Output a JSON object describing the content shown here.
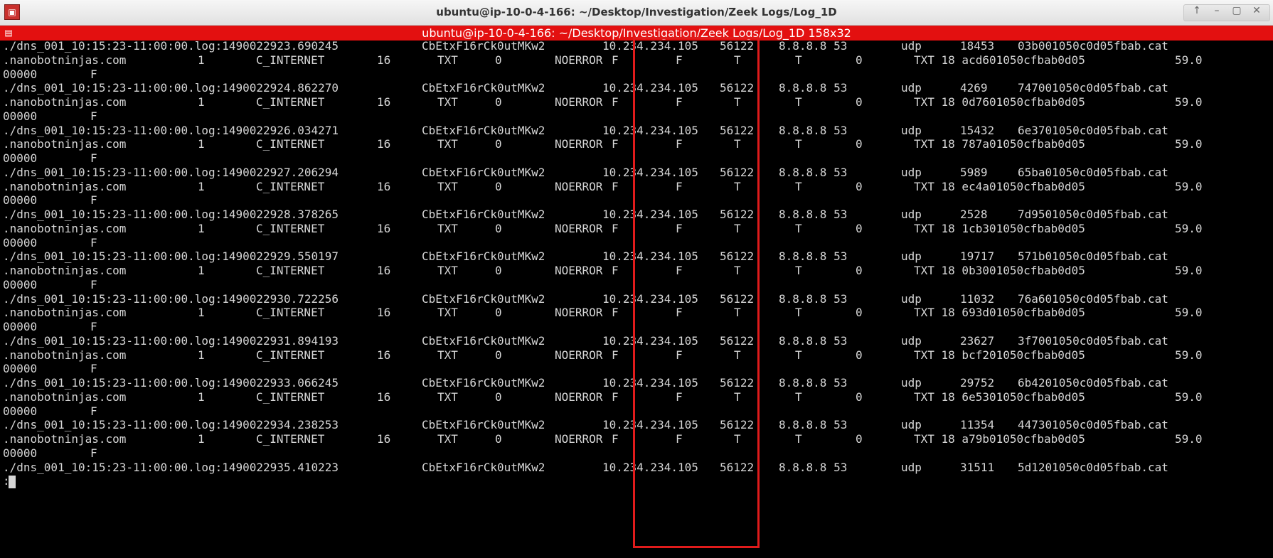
{
  "window": {
    "title": "ubuntu@ip-10-0-4-166: ~/Desktop/Investigation/Zeek Logs/Log_1D",
    "app_icon": "terminal-app-icon",
    "controls": [
      "↑",
      "–",
      "▢",
      "✕"
    ]
  },
  "terminal_bar": {
    "title": "ubuntu@ip-10-0-4-166: ~/Desktop/Investigation/Zeek Logs/Log_1D 158x32",
    "icon": "terminal-menu-icon"
  },
  "colors": {
    "terminal_bg": "#000000",
    "terminal_fg": "#d6d6d6",
    "terminal_bar": "#e31010",
    "highlight": "#e01b1b"
  },
  "records": [
    {
      "src": "./dns_001_10:15:23-11:00:00.log:1490022923.690245",
      "uid": "CbEtxF16rCk0utMKw2",
      "ip": "10.234.234.105",
      "port": "56122",
      "resp": "8.8.8.8 53",
      "proto": "udp",
      "trans": "18453",
      "qhead": "03b001050c0d05fbab.cat",
      "qtail": ".nanobotninjas.com",
      "c1": "1",
      "cname": "C_INTERNET",
      "qtype": "16",
      "qtname": "TXT",
      "rc": "0",
      "rcname": "NOERROR",
      "f1": "F",
      "f2": "F",
      "t1": "T",
      "t2": "T",
      "z": "0",
      "ans": "TXT 18 acd601050cfbab0d05",
      "ttl": "59.0",
      "wrap": "00000",
      "last": "F"
    },
    {
      "src": "./dns_001_10:15:23-11:00:00.log:1490022924.862270",
      "uid": "CbEtxF16rCk0utMKw2",
      "ip": "10.234.234.105",
      "port": "56122",
      "resp": "8.8.8.8 53",
      "proto": "udp",
      "trans": "4269",
      "qhead": "747001050c0d05fbab.cat",
      "qtail": ".nanobotninjas.com",
      "c1": "1",
      "cname": "C_INTERNET",
      "qtype": "16",
      "qtname": "TXT",
      "rc": "0",
      "rcname": "NOERROR",
      "f1": "F",
      "f2": "F",
      "t1": "T",
      "t2": "T",
      "z": "0",
      "ans": "TXT 18 0d7601050cfbab0d05",
      "ttl": "59.0",
      "wrap": "00000",
      "last": "F"
    },
    {
      "src": "./dns_001_10:15:23-11:00:00.log:1490022926.034271",
      "uid": "CbEtxF16rCk0utMKw2",
      "ip": "10.234.234.105",
      "port": "56122",
      "resp": "8.8.8.8 53",
      "proto": "udp",
      "trans": "15432",
      "qhead": "6e3701050c0d05fbab.cat",
      "qtail": ".nanobotninjas.com",
      "c1": "1",
      "cname": "C_INTERNET",
      "qtype": "16",
      "qtname": "TXT",
      "rc": "0",
      "rcname": "NOERROR",
      "f1": "F",
      "f2": "F",
      "t1": "T",
      "t2": "T",
      "z": "0",
      "ans": "TXT 18 787a01050cfbab0d05",
      "ttl": "59.0",
      "wrap": "00000",
      "last": "F"
    },
    {
      "src": "./dns_001_10:15:23-11:00:00.log:1490022927.206294",
      "uid": "CbEtxF16rCk0utMKw2",
      "ip": "10.234.234.105",
      "port": "56122",
      "resp": "8.8.8.8 53",
      "proto": "udp",
      "trans": "5989",
      "qhead": "65ba01050c0d05fbab.cat",
      "qtail": ".nanobotninjas.com",
      "c1": "1",
      "cname": "C_INTERNET",
      "qtype": "16",
      "qtname": "TXT",
      "rc": "0",
      "rcname": "NOERROR",
      "f1": "F",
      "f2": "F",
      "t1": "T",
      "t2": "T",
      "z": "0",
      "ans": "TXT 18 ec4a01050cfbab0d05",
      "ttl": "59.0",
      "wrap": "00000",
      "last": "F"
    },
    {
      "src": "./dns_001_10:15:23-11:00:00.log:1490022928.378265",
      "uid": "CbEtxF16rCk0utMKw2",
      "ip": "10.234.234.105",
      "port": "56122",
      "resp": "8.8.8.8 53",
      "proto": "udp",
      "trans": "2528",
      "qhead": "7d9501050c0d05fbab.cat",
      "qtail": ".nanobotninjas.com",
      "c1": "1",
      "cname": "C_INTERNET",
      "qtype": "16",
      "qtname": "TXT",
      "rc": "0",
      "rcname": "NOERROR",
      "f1": "F",
      "f2": "F",
      "t1": "T",
      "t2": "T",
      "z": "0",
      "ans": "TXT 18 1cb301050cfbab0d05",
      "ttl": "59.0",
      "wrap": "00000",
      "last": "F"
    },
    {
      "src": "./dns_001_10:15:23-11:00:00.log:1490022929.550197",
      "uid": "CbEtxF16rCk0utMKw2",
      "ip": "10.234.234.105",
      "port": "56122",
      "resp": "8.8.8.8 53",
      "proto": "udp",
      "trans": "19717",
      "qhead": "571b01050c0d05fbab.cat",
      "qtail": ".nanobotninjas.com",
      "c1": "1",
      "cname": "C_INTERNET",
      "qtype": "16",
      "qtname": "TXT",
      "rc": "0",
      "rcname": "NOERROR",
      "f1": "F",
      "f2": "F",
      "t1": "T",
      "t2": "T",
      "z": "0",
      "ans": "TXT 18 0b3001050cfbab0d05",
      "ttl": "59.0",
      "wrap": "00000",
      "last": "F"
    },
    {
      "src": "./dns_001_10:15:23-11:00:00.log:1490022930.722256",
      "uid": "CbEtxF16rCk0utMKw2",
      "ip": "10.234.234.105",
      "port": "56122",
      "resp": "8.8.8.8 53",
      "proto": "udp",
      "trans": "11032",
      "qhead": "76a601050c0d05fbab.cat",
      "qtail": ".nanobotninjas.com",
      "c1": "1",
      "cname": "C_INTERNET",
      "qtype": "16",
      "qtname": "TXT",
      "rc": "0",
      "rcname": "NOERROR",
      "f1": "F",
      "f2": "F",
      "t1": "T",
      "t2": "T",
      "z": "0",
      "ans": "TXT 18 693d01050cfbab0d05",
      "ttl": "59.0",
      "wrap": "00000",
      "last": "F"
    },
    {
      "src": "./dns_001_10:15:23-11:00:00.log:1490022931.894193",
      "uid": "CbEtxF16rCk0utMKw2",
      "ip": "10.234.234.105",
      "port": "56122",
      "resp": "8.8.8.8 53",
      "proto": "udp",
      "trans": "23627",
      "qhead": "3f7001050c0d05fbab.cat",
      "qtail": ".nanobotninjas.com",
      "c1": "1",
      "cname": "C_INTERNET",
      "qtype": "16",
      "qtname": "TXT",
      "rc": "0",
      "rcname": "NOERROR",
      "f1": "F",
      "f2": "F",
      "t1": "T",
      "t2": "T",
      "z": "0",
      "ans": "TXT 18 bcf201050cfbab0d05",
      "ttl": "59.0",
      "wrap": "00000",
      "last": "F"
    },
    {
      "src": "./dns_001_10:15:23-11:00:00.log:1490022933.066245",
      "uid": "CbEtxF16rCk0utMKw2",
      "ip": "10.234.234.105",
      "port": "56122",
      "resp": "8.8.8.8 53",
      "proto": "udp",
      "trans": "29752",
      "qhead": "6b4201050c0d05fbab.cat",
      "qtail": ".nanobotninjas.com",
      "c1": "1",
      "cname": "C_INTERNET",
      "qtype": "16",
      "qtname": "TXT",
      "rc": "0",
      "rcname": "NOERROR",
      "f1": "F",
      "f2": "F",
      "t1": "T",
      "t2": "T",
      "z": "0",
      "ans": "TXT 18 6e5301050cfbab0d05",
      "ttl": "59.0",
      "wrap": "00000",
      "last": "F"
    },
    {
      "src": "./dns_001_10:15:23-11:00:00.log:1490022934.238253",
      "uid": "CbEtxF16rCk0utMKw2",
      "ip": "10.234.234.105",
      "port": "56122",
      "resp": "8.8.8.8 53",
      "proto": "udp",
      "trans": "11354",
      "qhead": "447301050c0d05fbab.cat",
      "qtail": ".nanobotninjas.com",
      "c1": "1",
      "cname": "C_INTERNET",
      "qtype": "16",
      "qtname": "TXT",
      "rc": "0",
      "rcname": "NOERROR",
      "f1": "F",
      "f2": "F",
      "t1": "T",
      "t2": "T",
      "z": "0",
      "ans": "TXT 18 a79b01050cfbab0d05",
      "ttl": "59.0",
      "wrap": "00000",
      "last": "F"
    },
    {
      "src": "./dns_001_10:15:23-11:00:00.log:1490022935.410223",
      "uid": "CbEtxF16rCk0utMKw2",
      "ip": "10.234.234.105",
      "port": "56122",
      "resp": "8.8.8.8 53",
      "proto": "udp",
      "trans": "31511",
      "qhead": "5d1201050c0d05fbab.cat"
    }
  ],
  "prompt": ":"
}
